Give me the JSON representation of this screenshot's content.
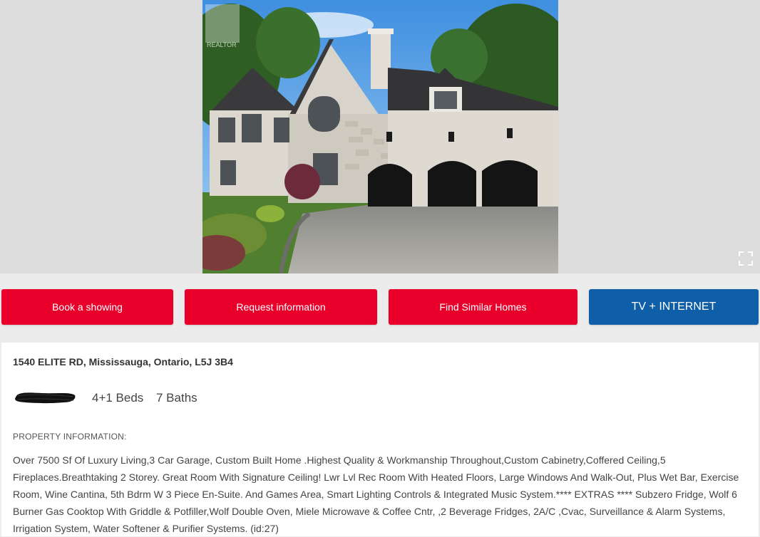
{
  "gallery": {
    "photo_alt": "Property photo",
    "watermark": "REALTOR",
    "expand_icon": "fullscreen-icon"
  },
  "actions": {
    "book_showing": "Book a showing",
    "request_info": "Request information",
    "find_similar": "Find Similar Homes",
    "tv_internet": "TV + INTERNET"
  },
  "listing": {
    "address": "1540 ELITE RD, Mississauga, Ontario, L5J 3B4",
    "beds": "4+1 Beds",
    "baths": "7 Baths",
    "section_title": "PROPERTY INFORMATION:",
    "description": "Over 7500 Sf Of Luxury Living,3 Car Garage, Custom Built Home .Highest Quality & Workmanship Throughout,Custom Cabinetry,Coffered Ceiling,5 Fireplaces.Breathtaking 2 Storey. Great Room With Signature Ceiling! Lwr Lvl Rec Room With Heated Floors, Large Windows And Walk-Out, Plus Wet Bar, Exercise Room, Wine Cantina, 5th Bdrm W 3 Piece En-Suite. And Games Area, Smart Lighting Controls & Integrated Music System.**** EXTRAS **** Subzero Fridge, Wolf 6 Burner Gas Cooktop With Griddle & Potfiller,Wolf Double Oven, Miele Microwave & Coffee Cntr, ,2 Beverage Fridges, 2A/C ,Cvac, Surveillance & Alarm Systems, Irrigation System, Water Softener & Purifier Systems. (id:27)"
  },
  "colors": {
    "action_red": "#e8002b",
    "action_blue": "#0f5ea8",
    "gallery_bg": "#dcdcdc",
    "page_bg": "#ececec"
  }
}
